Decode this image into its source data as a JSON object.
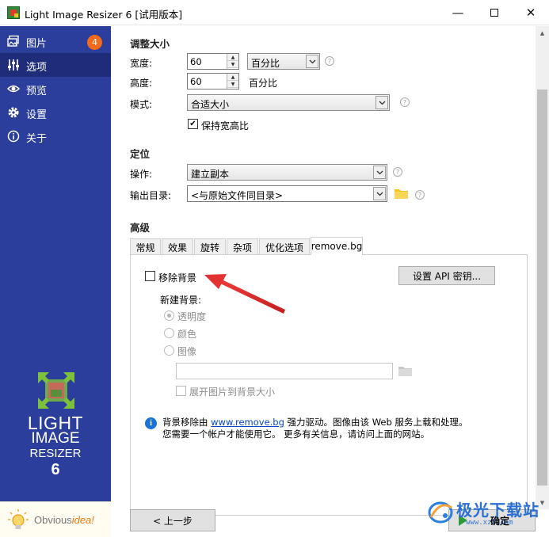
{
  "window": {
    "title": "Light Image Resizer 6  [试用版本]",
    "minimize": "—",
    "close": "✕"
  },
  "sidebar": {
    "items": [
      {
        "label": "图片",
        "badge": "4",
        "icon": "pictures-icon"
      },
      {
        "label": "选项",
        "icon": "sliders-icon",
        "active": true
      },
      {
        "label": "预览",
        "icon": "eye-icon"
      },
      {
        "label": "设置",
        "icon": "gear-icon"
      },
      {
        "label": "关于",
        "icon": "info-icon"
      }
    ],
    "logo": {
      "line1": "LIGHT",
      "line2": "IMAGE",
      "line3": "RESIZER",
      "line4": "6"
    },
    "brand": {
      "part1": "Obvious",
      "part2": "idea!"
    }
  },
  "resize": {
    "section_title": "调整大小",
    "width_label": "宽度:",
    "width_value": "60",
    "width_unit": "百分比",
    "height_label": "高度:",
    "height_value": "60",
    "height_unit": "百分比",
    "mode_label": "模式:",
    "mode_value": "合适大小",
    "keep_ratio_label": "保持宽高比",
    "keep_ratio_checked": true
  },
  "position": {
    "section_title": "定位",
    "action_label": "操作:",
    "action_value": "建立副本",
    "output_label": "输出目录:",
    "output_value": "<与原始文件同目录>"
  },
  "advanced": {
    "section_title": "高级",
    "tabs": [
      "常规",
      "效果",
      "旋转",
      "杂项",
      "优化选项",
      "remove.bg"
    ],
    "active_tab": "remove.bg",
    "remove_bg_label": "移除背景",
    "api_key_button": "设置 API 密钥...",
    "new_bg_label": "新建背景:",
    "options": [
      "透明度",
      "颜色",
      "图像"
    ],
    "expand_label": "展开图片到背景大小",
    "info_text_before": "背景移除由 ",
    "info_link": "www.remove.bg",
    "info_text_after": " 强力驱动。图像由该 Web 服务上载和处理。",
    "info_line2": "您需要一个帐户才能使用它。 更多有关信息，请访问上面的网站。"
  },
  "footer": {
    "back_button": "< 上一步",
    "ok_button": "确定"
  },
  "watermark": {
    "text": "极光下载站",
    "sub": "www.xz7.com"
  },
  "colors": {
    "sidebar": "#2c3e9c",
    "sidebar_active": "#1e2c7a",
    "badge": "#f26b1d",
    "arrow": "#d92b2b",
    "link": "#0645c8"
  }
}
